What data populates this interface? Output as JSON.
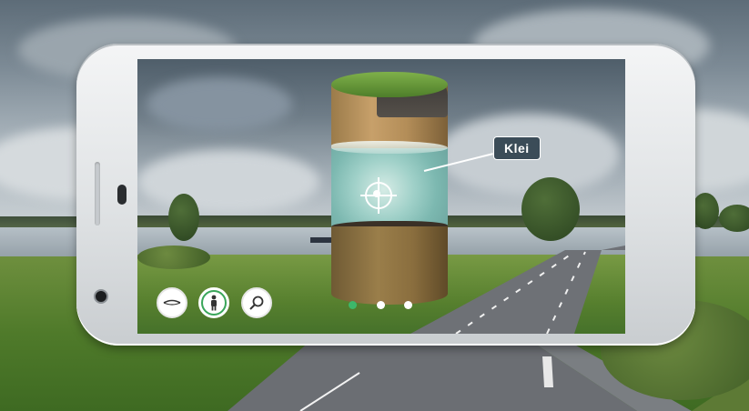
{
  "ar_overlay": {
    "layer_label": "Klei"
  },
  "toolbar": {
    "buttons": [
      {
        "name": "horizon-view-button",
        "icon": "horizon-icon",
        "active": false
      },
      {
        "name": "person-view-button",
        "icon": "person-icon",
        "active": true
      },
      {
        "name": "search-button",
        "icon": "magnifier-icon",
        "active": false
      }
    ]
  },
  "pager": {
    "pages": 3,
    "current_index": 0
  },
  "colors": {
    "accent_green": "#3aa65a",
    "label_background": "#3b4c58"
  }
}
